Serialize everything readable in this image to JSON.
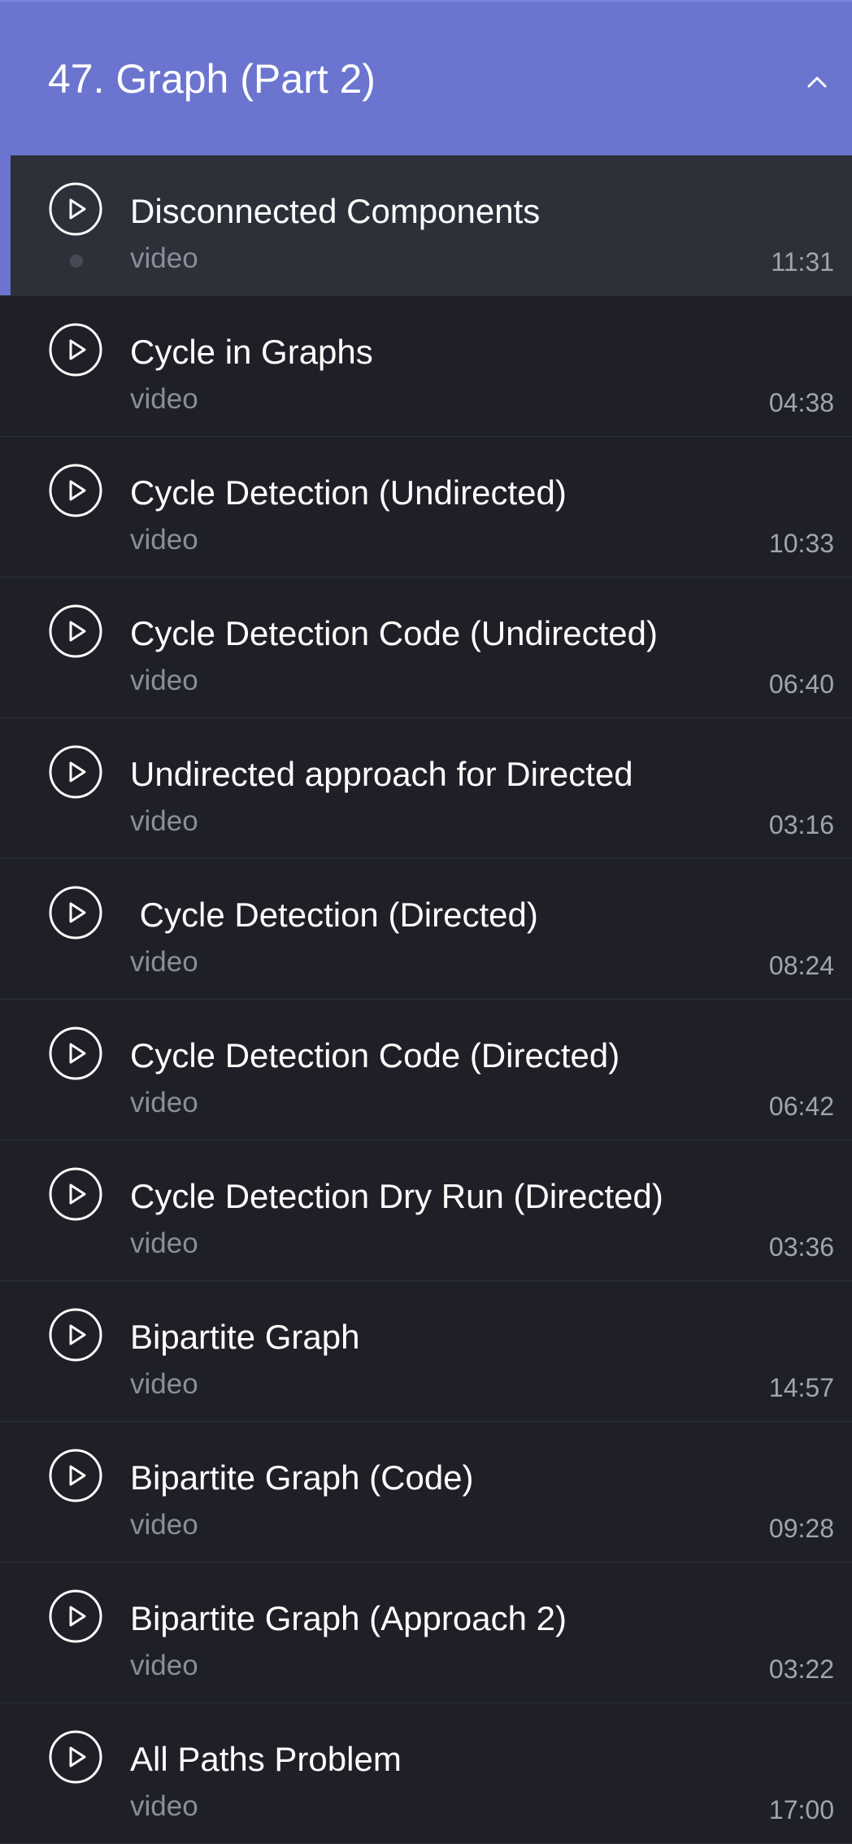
{
  "section": {
    "title": "47. Graph (Part 2)",
    "icon": "chevron-up-icon",
    "accent_color": "#6b75d0"
  },
  "lessons": [
    {
      "title": "Disconnected Components",
      "type": "video",
      "duration": "11:31",
      "active": true
    },
    {
      "title": "Cycle in Graphs",
      "type": "video",
      "duration": "04:38"
    },
    {
      "title": "Cycle Detection (Undirected)",
      "type": "video",
      "duration": "10:33"
    },
    {
      "title": "Cycle Detection Code (Undirected)",
      "type": "video",
      "duration": "06:40"
    },
    {
      "title": "Undirected approach for Directed",
      "type": "video",
      "duration": "03:16"
    },
    {
      "title": " Cycle Detection (Directed)",
      "type": "video",
      "duration": "08:24"
    },
    {
      "title": "Cycle Detection Code (Directed)",
      "type": "video",
      "duration": "06:42"
    },
    {
      "title": "Cycle Detection Dry Run (Directed)",
      "type": "video",
      "duration": "03:36"
    },
    {
      "title": "Bipartite Graph",
      "type": "video",
      "duration": "14:57"
    },
    {
      "title": "Bipartite Graph (Code)",
      "type": "video",
      "duration": "09:28"
    },
    {
      "title": "Bipartite Graph (Approach 2)",
      "type": "video",
      "duration": "03:22"
    },
    {
      "title": "All Paths Problem",
      "type": "video",
      "duration": "17:00"
    }
  ]
}
